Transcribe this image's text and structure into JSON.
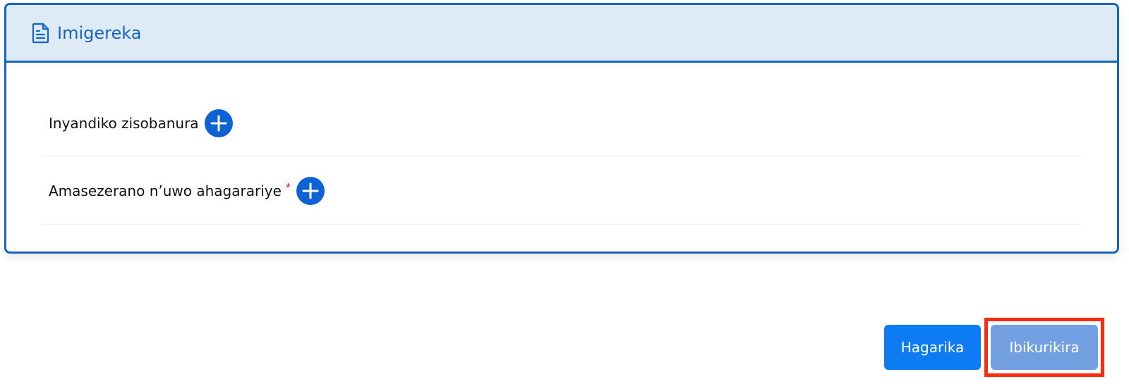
{
  "section": {
    "title": "Imigereka",
    "icon": "document-icon"
  },
  "fields": [
    {
      "label": "Inyandiko zisobanura",
      "required": false,
      "add_icon": "plus-circle-icon"
    },
    {
      "label": "Amasezerano n’uwo ahagarariye",
      "required": true,
      "required_mark": "*",
      "add_icon": "plus-circle-icon"
    }
  ],
  "actions": {
    "cancel_label": "Hagarika",
    "next_label": "Ibikurikira"
  },
  "colors": {
    "accent": "#1565c0",
    "header_bg": "#deebf7",
    "primary_button": "#0d7cf2",
    "disabled_button": "#72a0e2",
    "required": "#e0282e",
    "highlight": "#ff2a12"
  }
}
